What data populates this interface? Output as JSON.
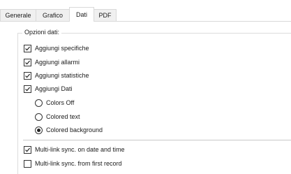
{
  "tabs": [
    {
      "label": "Generale",
      "active": false
    },
    {
      "label": "Grafico",
      "active": false
    },
    {
      "label": "Dati",
      "active": true
    },
    {
      "label": "PDF",
      "active": false
    }
  ],
  "group": {
    "title": "Opzioni dati:"
  },
  "checkboxes": [
    {
      "label": "Aggiungi specifiche",
      "checked": true
    },
    {
      "label": "Aggiungi allarmi",
      "checked": true
    },
    {
      "label": "Aggiungi statistiche",
      "checked": true
    },
    {
      "label": "Aggiungi Dati",
      "checked": true
    }
  ],
  "color_mode": {
    "options": [
      {
        "label": "Colors Off",
        "selected": false
      },
      {
        "label": "Colored text",
        "selected": false
      },
      {
        "label": "Colored background",
        "selected": true
      }
    ]
  },
  "sync": [
    {
      "label": "Multi-link sync. on date and time",
      "checked": true
    },
    {
      "label": "Multi-link sync. from first record",
      "checked": false
    }
  ]
}
